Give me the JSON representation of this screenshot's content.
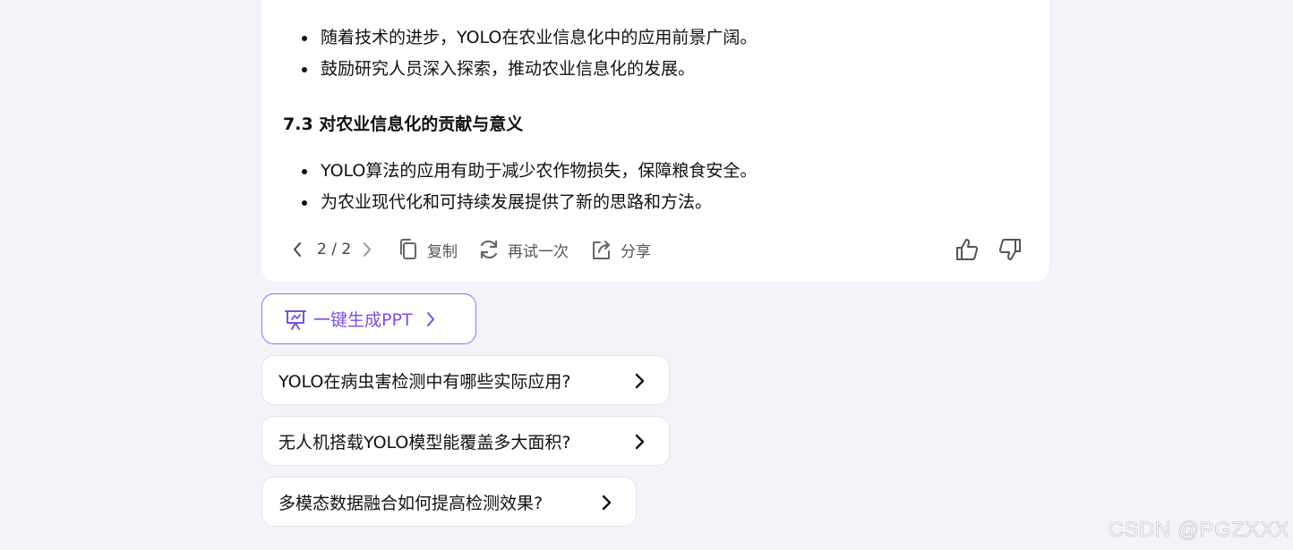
{
  "answer": {
    "bullets_top": [
      "随着技术的进步，YOLO在农业信息化中的应用前景广阔。",
      "鼓励研究人员深入探索，推动农业信息化的发展。"
    ],
    "section_title": "7.3 对农业信息化的贡献与意义",
    "bullets_bottom": [
      "YOLO算法的应用有助于减少农作物损失，保障粮食安全。",
      "为农业现代化和可持续发展提供了新的思路和方法。"
    ]
  },
  "actions": {
    "pager": "2 / 2",
    "copy_label": "复制",
    "retry_label": "再试一次",
    "share_label": "分享"
  },
  "ppt_button": {
    "label": "一键生成PPT",
    "color": "#7c4ee0"
  },
  "suggestions": [
    "YOLO在病虫害检测中有哪些实际应用?",
    "无人机搭载YOLO模型能覆盖多大面积?",
    "多模态数据融合如何提高检测效果?"
  ],
  "watermark": "CSDN @PGZXXX"
}
